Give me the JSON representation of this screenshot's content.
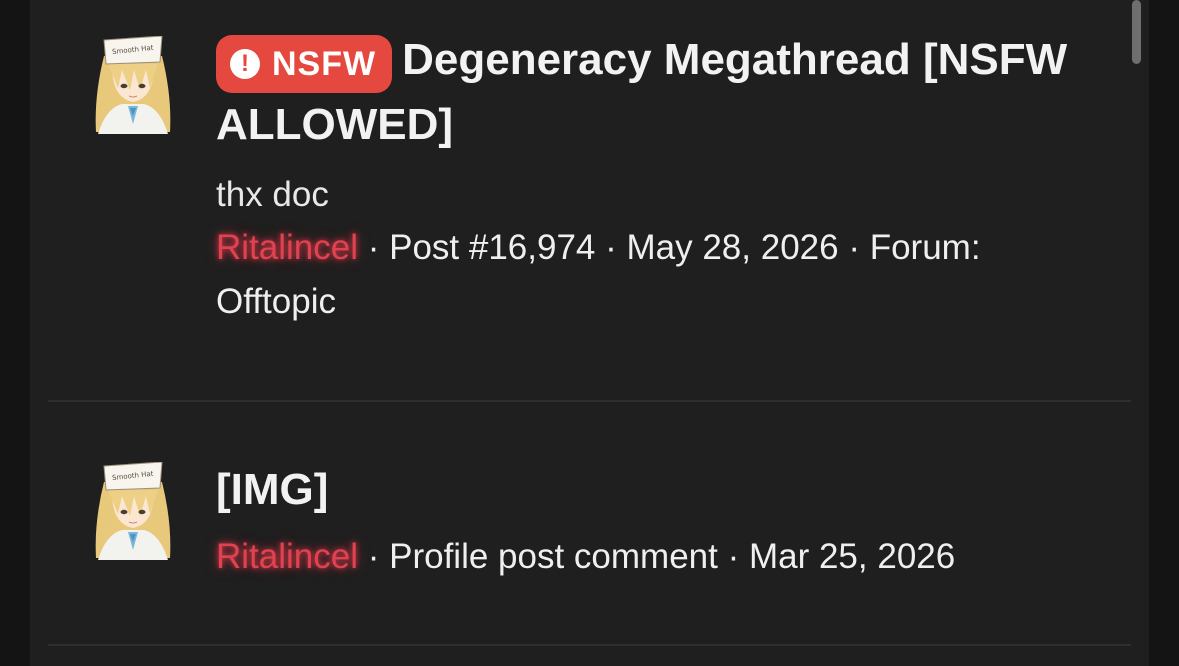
{
  "results": [
    {
      "badge": "NSFW",
      "title": "Degeneracy Megathread [NSFW ALLOWED]",
      "snippet": "thx doc",
      "user": "Ritalincel",
      "separator": " · ",
      "type": "Post #16,974",
      "date": "May 28, 2026",
      "forum_label": "Forum: Offtopic"
    },
    {
      "title": "[IMG]",
      "user": "Ritalincel",
      "separator": " · ",
      "type": "Profile post comment",
      "date": "Mar 25, 2026"
    }
  ],
  "avatar": {
    "hat_text": "Smooth Hat"
  },
  "colors": {
    "badge": "#e5483f",
    "username": "#e0424f",
    "panel": "#1f1f1f"
  },
  "icons": {
    "badge_icon": "exclamation-circle-icon"
  }
}
